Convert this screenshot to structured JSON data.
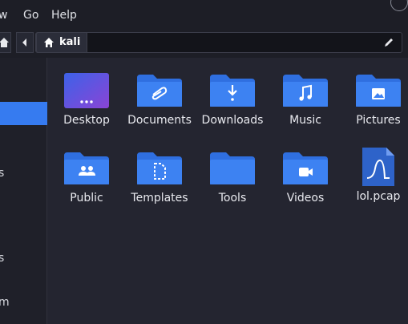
{
  "menubar": {
    "items": [
      "w",
      "Go",
      "Help"
    ]
  },
  "pathbar": {
    "location": "kali"
  },
  "sidebar": {
    "fragments": [
      "s",
      "s",
      "m"
    ]
  },
  "colors": {
    "accent": "#367bf0",
    "folder": "#2f6fe0",
    "folder_tab": "#3d82f2",
    "background": "#242530"
  },
  "files": [
    {
      "name": "Desktop",
      "icon": "desktop-folder-icon"
    },
    {
      "name": "Documents",
      "icon": "documents-folder-icon"
    },
    {
      "name": "Downloads",
      "icon": "downloads-folder-icon"
    },
    {
      "name": "Music",
      "icon": "music-folder-icon"
    },
    {
      "name": "Pictures",
      "icon": "pictures-folder-icon"
    },
    {
      "name": "Public",
      "icon": "public-folder-icon"
    },
    {
      "name": "Templates",
      "icon": "templates-folder-icon"
    },
    {
      "name": "Tools",
      "icon": "folder-icon"
    },
    {
      "name": "Videos",
      "icon": "videos-folder-icon"
    },
    {
      "name": "lol.pcap",
      "icon": "pcap-file-icon"
    }
  ]
}
